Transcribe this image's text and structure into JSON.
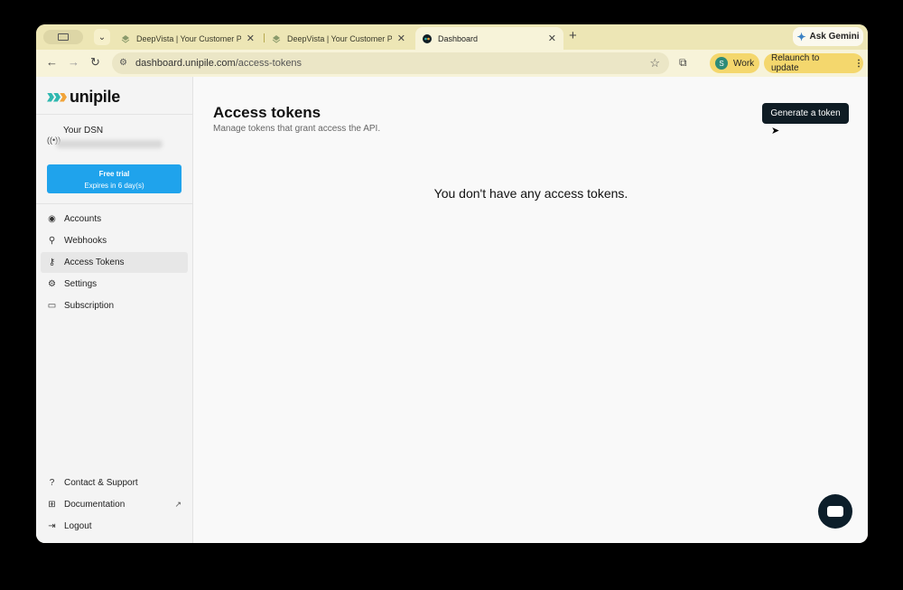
{
  "browser": {
    "tabs": [
      {
        "label": "DeepVista | Your Customer Pl",
        "active": false
      },
      {
        "label": "DeepVista | Your Customer Pl",
        "active": false
      },
      {
        "label": "Dashboard",
        "active": true
      }
    ],
    "gemini_label": "Ask Gemini",
    "url_host": "dashboard.unipile.com",
    "url_path": "/access-tokens",
    "profile_initial": "S",
    "profile_label": "Work",
    "relaunch_label": "Relaunch to update"
  },
  "sidebar": {
    "logo_text": "unipile",
    "dsn_title": "Your DSN",
    "trial_title": "Free trial",
    "trial_expiry": "Expires in 6 day(s)",
    "nav_items": [
      {
        "label": "Accounts",
        "icon": "user-circle-icon",
        "active": false
      },
      {
        "label": "Webhooks",
        "icon": "webhook-icon",
        "active": false
      },
      {
        "label": "Access Tokens",
        "icon": "key-icon",
        "active": true
      },
      {
        "label": "Settings",
        "icon": "gear-icon",
        "active": false
      },
      {
        "label": "Subscription",
        "icon": "credit-card-icon",
        "active": false
      }
    ],
    "footer_items": [
      {
        "label": "Contact & Support",
        "icon": "help-circle-icon"
      },
      {
        "label": "Documentation",
        "icon": "book-icon"
      },
      {
        "label": "Logout",
        "icon": "logout-icon"
      }
    ]
  },
  "main": {
    "title": "Access tokens",
    "subtitle": "Manage tokens that grant access the API.",
    "generate_button": "Generate a token",
    "empty_message": "You don't have any access tokens."
  },
  "colors": {
    "brand_teal": "#2fb8b0",
    "brand_orange": "#f1a43a",
    "trial_blue": "#1fa3ec",
    "primary_dark": "#0f1c24"
  }
}
